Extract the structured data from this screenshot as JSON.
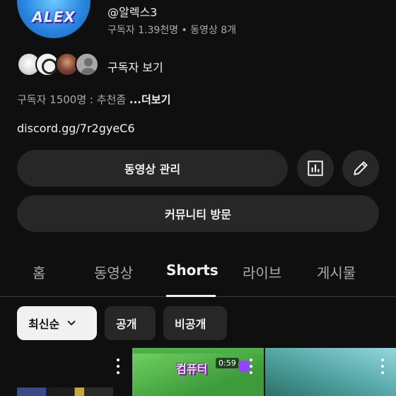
{
  "channel": {
    "avatar_text": "ALEX",
    "handle": "@알렉스3",
    "stats": "구독자 1.39천명 • 동영상 8개"
  },
  "subscribers": {
    "label": "구독자 보기"
  },
  "description": {
    "text": "구독자 1500명 : 추천좀 ",
    "more": "...더보기"
  },
  "link": "discord.gg/7r2gyeC6",
  "buttons": {
    "manage": "동영상 관리",
    "community": "커뮤니티 방문"
  },
  "tabs": [
    {
      "label": "홈"
    },
    {
      "label": "동영상"
    },
    {
      "label": "Shorts"
    },
    {
      "label": "라이브"
    },
    {
      "label": "게시물"
    }
  ],
  "filters": {
    "sort": "최신순",
    "public": "공개",
    "private": "비공개"
  },
  "shorts": [
    {},
    {
      "overlay_title": "컴퓨터",
      "timer": "0:59"
    },
    {}
  ],
  "colors": {
    "background": "#0f0f0f",
    "surface": "#272727",
    "text": "#f1f1f1",
    "muted": "#aaaaaa"
  },
  "icons": {
    "analytics": "bar-chart-icon",
    "edit": "pencil-icon",
    "sort_dropdown": "chevron-down-icon",
    "more": "kebab-menu-icon"
  }
}
